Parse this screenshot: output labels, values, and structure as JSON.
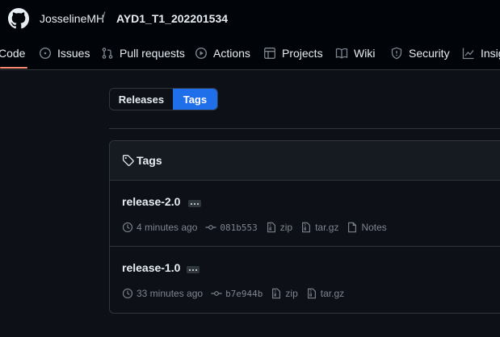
{
  "header": {
    "owner": "JosselineMH",
    "separator": "/",
    "repo": "AYD1_T1_202201534",
    "tabs": [
      {
        "label": "Code",
        "icon": "code-icon"
      },
      {
        "label": "Issues",
        "icon": "issue-opened-icon"
      },
      {
        "label": "Pull requests",
        "icon": "git-pull-request-icon"
      },
      {
        "label": "Actions",
        "icon": "play-icon"
      },
      {
        "label": "Projects",
        "icon": "table-icon"
      },
      {
        "label": "Wiki",
        "icon": "book-icon"
      },
      {
        "label": "Security",
        "icon": "shield-icon"
      },
      {
        "label": "Insig",
        "icon": "graph-icon"
      }
    ]
  },
  "segmented": {
    "releases_label": "Releases",
    "tags_label": "Tags",
    "active": "Tags"
  },
  "tags_box": {
    "title": "Tags",
    "rows": [
      {
        "name": "release-2.0",
        "time": "4 minutes ago",
        "sha": "081b553",
        "zip": "zip",
        "targz": "tar.gz",
        "notes": "Notes"
      },
      {
        "name": "release-1.0",
        "time": "33 minutes ago",
        "sha": "b7e944b",
        "zip": "zip",
        "targz": "tar.gz"
      }
    ]
  },
  "colors": {
    "page_bg": "#0d1117",
    "header_bg": "#010409",
    "accent_blue": "#1f6feb",
    "tab_underline": "#fd8c73",
    "border": "#30363d",
    "muted": "#7d8590"
  }
}
